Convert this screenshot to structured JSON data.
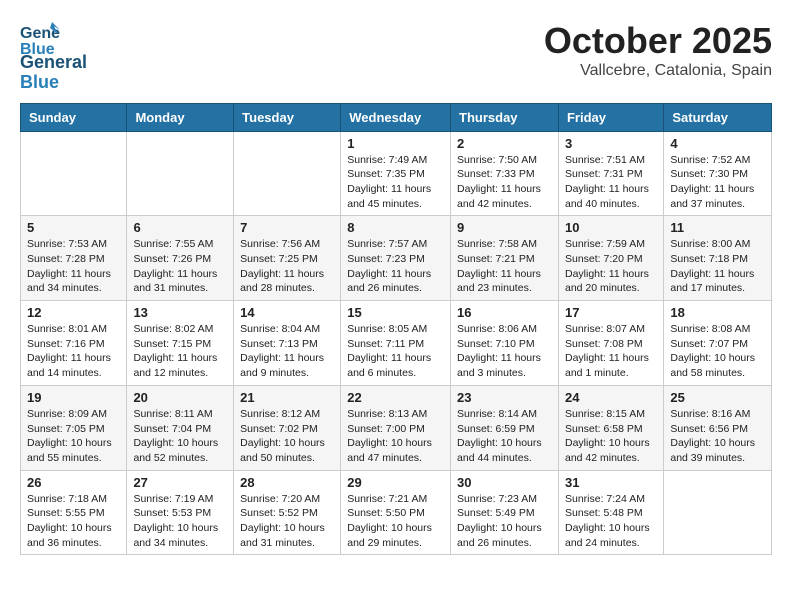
{
  "header": {
    "logo_general": "General",
    "logo_blue": "Blue",
    "month": "October 2025",
    "location": "Vallcebre, Catalonia, Spain"
  },
  "weekdays": [
    "Sunday",
    "Monday",
    "Tuesday",
    "Wednesday",
    "Thursday",
    "Friday",
    "Saturday"
  ],
  "weeks": [
    [
      {
        "day": "",
        "info": ""
      },
      {
        "day": "",
        "info": ""
      },
      {
        "day": "",
        "info": ""
      },
      {
        "day": "1",
        "info": "Sunrise: 7:49 AM\nSunset: 7:35 PM\nDaylight: 11 hours\nand 45 minutes."
      },
      {
        "day": "2",
        "info": "Sunrise: 7:50 AM\nSunset: 7:33 PM\nDaylight: 11 hours\nand 42 minutes."
      },
      {
        "day": "3",
        "info": "Sunrise: 7:51 AM\nSunset: 7:31 PM\nDaylight: 11 hours\nand 40 minutes."
      },
      {
        "day": "4",
        "info": "Sunrise: 7:52 AM\nSunset: 7:30 PM\nDaylight: 11 hours\nand 37 minutes."
      }
    ],
    [
      {
        "day": "5",
        "info": "Sunrise: 7:53 AM\nSunset: 7:28 PM\nDaylight: 11 hours\nand 34 minutes."
      },
      {
        "day": "6",
        "info": "Sunrise: 7:55 AM\nSunset: 7:26 PM\nDaylight: 11 hours\nand 31 minutes."
      },
      {
        "day": "7",
        "info": "Sunrise: 7:56 AM\nSunset: 7:25 PM\nDaylight: 11 hours\nand 28 minutes."
      },
      {
        "day": "8",
        "info": "Sunrise: 7:57 AM\nSunset: 7:23 PM\nDaylight: 11 hours\nand 26 minutes."
      },
      {
        "day": "9",
        "info": "Sunrise: 7:58 AM\nSunset: 7:21 PM\nDaylight: 11 hours\nand 23 minutes."
      },
      {
        "day": "10",
        "info": "Sunrise: 7:59 AM\nSunset: 7:20 PM\nDaylight: 11 hours\nand 20 minutes."
      },
      {
        "day": "11",
        "info": "Sunrise: 8:00 AM\nSunset: 7:18 PM\nDaylight: 11 hours\nand 17 minutes."
      }
    ],
    [
      {
        "day": "12",
        "info": "Sunrise: 8:01 AM\nSunset: 7:16 PM\nDaylight: 11 hours\nand 14 minutes."
      },
      {
        "day": "13",
        "info": "Sunrise: 8:02 AM\nSunset: 7:15 PM\nDaylight: 11 hours\nand 12 minutes."
      },
      {
        "day": "14",
        "info": "Sunrise: 8:04 AM\nSunset: 7:13 PM\nDaylight: 11 hours\nand 9 minutes."
      },
      {
        "day": "15",
        "info": "Sunrise: 8:05 AM\nSunset: 7:11 PM\nDaylight: 11 hours\nand 6 minutes."
      },
      {
        "day": "16",
        "info": "Sunrise: 8:06 AM\nSunset: 7:10 PM\nDaylight: 11 hours\nand 3 minutes."
      },
      {
        "day": "17",
        "info": "Sunrise: 8:07 AM\nSunset: 7:08 PM\nDaylight: 11 hours\nand 1 minute."
      },
      {
        "day": "18",
        "info": "Sunrise: 8:08 AM\nSunset: 7:07 PM\nDaylight: 10 hours\nand 58 minutes."
      }
    ],
    [
      {
        "day": "19",
        "info": "Sunrise: 8:09 AM\nSunset: 7:05 PM\nDaylight: 10 hours\nand 55 minutes."
      },
      {
        "day": "20",
        "info": "Sunrise: 8:11 AM\nSunset: 7:04 PM\nDaylight: 10 hours\nand 52 minutes."
      },
      {
        "day": "21",
        "info": "Sunrise: 8:12 AM\nSunset: 7:02 PM\nDaylight: 10 hours\nand 50 minutes."
      },
      {
        "day": "22",
        "info": "Sunrise: 8:13 AM\nSunset: 7:00 PM\nDaylight: 10 hours\nand 47 minutes."
      },
      {
        "day": "23",
        "info": "Sunrise: 8:14 AM\nSunset: 6:59 PM\nDaylight: 10 hours\nand 44 minutes."
      },
      {
        "day": "24",
        "info": "Sunrise: 8:15 AM\nSunset: 6:58 PM\nDaylight: 10 hours\nand 42 minutes."
      },
      {
        "day": "25",
        "info": "Sunrise: 8:16 AM\nSunset: 6:56 PM\nDaylight: 10 hours\nand 39 minutes."
      }
    ],
    [
      {
        "day": "26",
        "info": "Sunrise: 7:18 AM\nSunset: 5:55 PM\nDaylight: 10 hours\nand 36 minutes."
      },
      {
        "day": "27",
        "info": "Sunrise: 7:19 AM\nSunset: 5:53 PM\nDaylight: 10 hours\nand 34 minutes."
      },
      {
        "day": "28",
        "info": "Sunrise: 7:20 AM\nSunset: 5:52 PM\nDaylight: 10 hours\nand 31 minutes."
      },
      {
        "day": "29",
        "info": "Sunrise: 7:21 AM\nSunset: 5:50 PM\nDaylight: 10 hours\nand 29 minutes."
      },
      {
        "day": "30",
        "info": "Sunrise: 7:23 AM\nSunset: 5:49 PM\nDaylight: 10 hours\nand 26 minutes."
      },
      {
        "day": "31",
        "info": "Sunrise: 7:24 AM\nSunset: 5:48 PM\nDaylight: 10 hours\nand 24 minutes."
      },
      {
        "day": "",
        "info": ""
      }
    ]
  ]
}
